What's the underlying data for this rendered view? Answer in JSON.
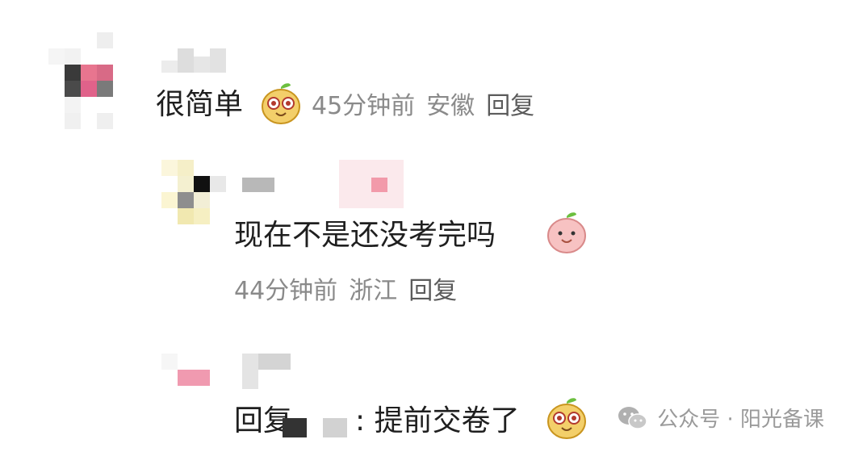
{
  "comments": [
    {
      "text": "很简单",
      "time": "45分钟前",
      "location": "安徽",
      "reply": "回复",
      "emoji": "smiling-face-emoji"
    },
    {
      "text": "现在不是还没考完吗",
      "time": "44分钟前",
      "location": "浙江",
      "reply": "回复",
      "emoji": "peach-face-emoji"
    },
    {
      "text_prefix": "回复",
      "text_colon": ":",
      "text": "提前交卷了",
      "emoji": "smiling-face-emoji"
    }
  ],
  "watermark": {
    "icon": "wechat-icon",
    "text": "公众号 · 阳光备课"
  }
}
